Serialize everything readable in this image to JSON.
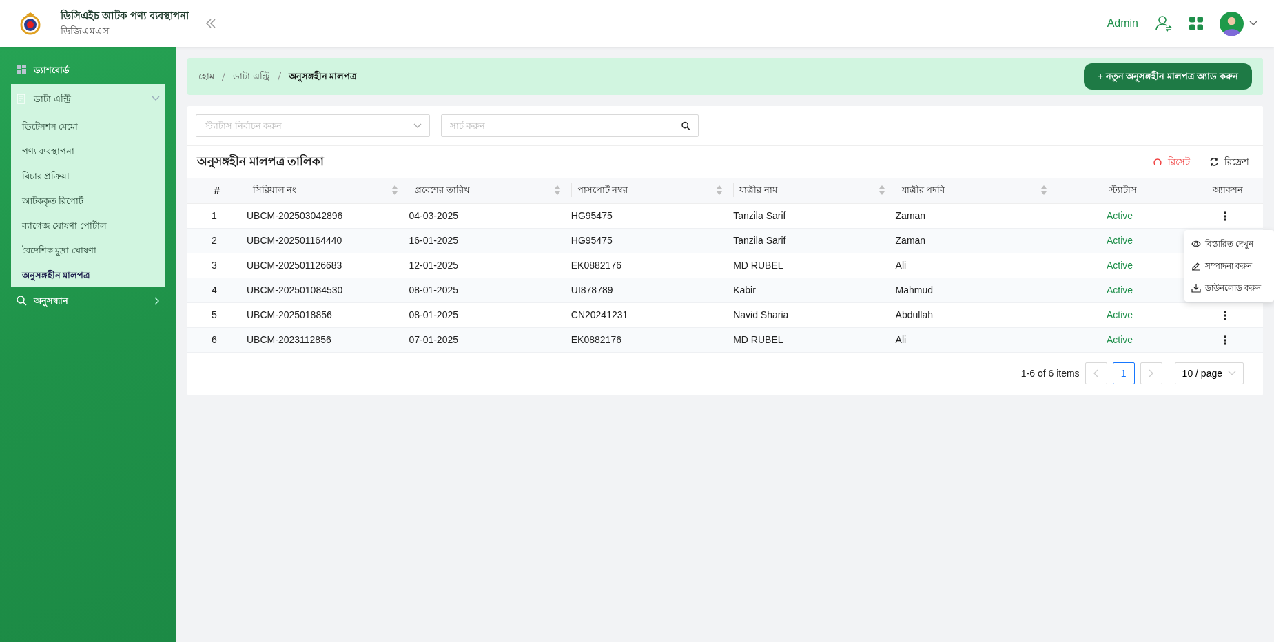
{
  "header": {
    "title": "ডিসিএইচ আটক পণ্য ব্যবস্থাপনা",
    "subtitle": "ডিজিএমএস",
    "user_link": "Admin"
  },
  "sidebar": {
    "items": [
      {
        "label": "ড্যাশবোর্ড"
      },
      {
        "label": "ডাটা এন্ট্রি",
        "expanded": true,
        "children": [
          {
            "label": "ডিটেনশন মেমো",
            "selected": false
          },
          {
            "label": "পণ্য ব্যবস্থাপনা",
            "selected": false
          },
          {
            "label": "বিচার প্রক্রিয়া",
            "selected": false
          },
          {
            "label": "আটককৃত রিপোর্ট",
            "selected": false
          },
          {
            "label": "ব্যাগেজ ঘোষণা পোর্টাল",
            "selected": false
          },
          {
            "label": "বৈদেশিক মুদ্রা ঘোষণা",
            "selected": false
          },
          {
            "label": "অনুসঙ্গহীন মালপত্র",
            "selected": true
          }
        ]
      },
      {
        "label": "অনুসন্ধান",
        "expanded": false
      }
    ]
  },
  "breadcrumb": [
    "হোম",
    "ডাটা এন্ট্রি",
    "অনুসঙ্গহীন মালপত্র"
  ],
  "add_button": "+ নতুন অনুসঙ্গহীন মালপত্র অ্যাড করুন",
  "filters": {
    "status_placeholder": "স্ট্যাটাস নির্বাচন করুন",
    "search_placeholder": "সার্চ করুন"
  },
  "table": {
    "title": "অনুসঙ্গহীন মালপত্র তালিকা",
    "reset": "রিসেট",
    "refresh": "রিফ্রেশ",
    "columns": [
      {
        "label": "#",
        "sortable": false
      },
      {
        "label": "সিরিয়াল নং",
        "sortable": true
      },
      {
        "label": "প্রবেশের তারিখ",
        "sortable": true
      },
      {
        "label": "পাসপোর্ট নম্বর",
        "sortable": true
      },
      {
        "label": "যাত্রীর নাম",
        "sortable": true
      },
      {
        "label": "যাত্রীর পদবি",
        "sortable": true
      },
      {
        "label": "স্ট্যাটাস",
        "sortable": false
      },
      {
        "label": "অ্যাকশন",
        "sortable": false
      }
    ],
    "rows": [
      {
        "cells": [
          "1",
          "UBCM-202503042896",
          "04-03-2025",
          "HG95475",
          "Tanzila Sarif",
          "Zaman",
          "Active"
        ],
        "menu_open": false
      },
      {
        "cells": [
          "2",
          "UBCM-202501164440",
          "16-01-2025",
          "HG95475",
          "Tanzila Sarif",
          "Zaman",
          "Active"
        ],
        "menu_open": true
      },
      {
        "cells": [
          "3",
          "UBCM-202501126683",
          "12-01-2025",
          "EK0882176",
          "MD RUBEL",
          "Ali",
          "Active"
        ],
        "menu_open": false
      },
      {
        "cells": [
          "4",
          "UBCM-202501084530",
          "08-01-2025",
          "UI878789",
          "Kabir",
          "Mahmud",
          "Active"
        ],
        "menu_open": false
      },
      {
        "cells": [
          "5",
          "UBCM-2025018856",
          "08-01-2025",
          "CN20241231",
          "Navid Sharia",
          "Abdullah",
          "Active"
        ],
        "menu_open": false
      },
      {
        "cells": [
          "6",
          "UBCM-2023112856",
          "07-01-2025",
          "EK0882176",
          "MD RUBEL",
          "Ali",
          "Active"
        ],
        "menu_open": false
      }
    ],
    "action_menu": [
      "বিস্তারিত দেখুন",
      "সম্পাদনা করুন",
      "ডাউনলোড করুন"
    ]
  },
  "pagination": {
    "summary": "1-6 of 6 items",
    "pages": [
      {
        "label": "1",
        "selected": true
      }
    ],
    "page_size": "10 / page"
  }
}
